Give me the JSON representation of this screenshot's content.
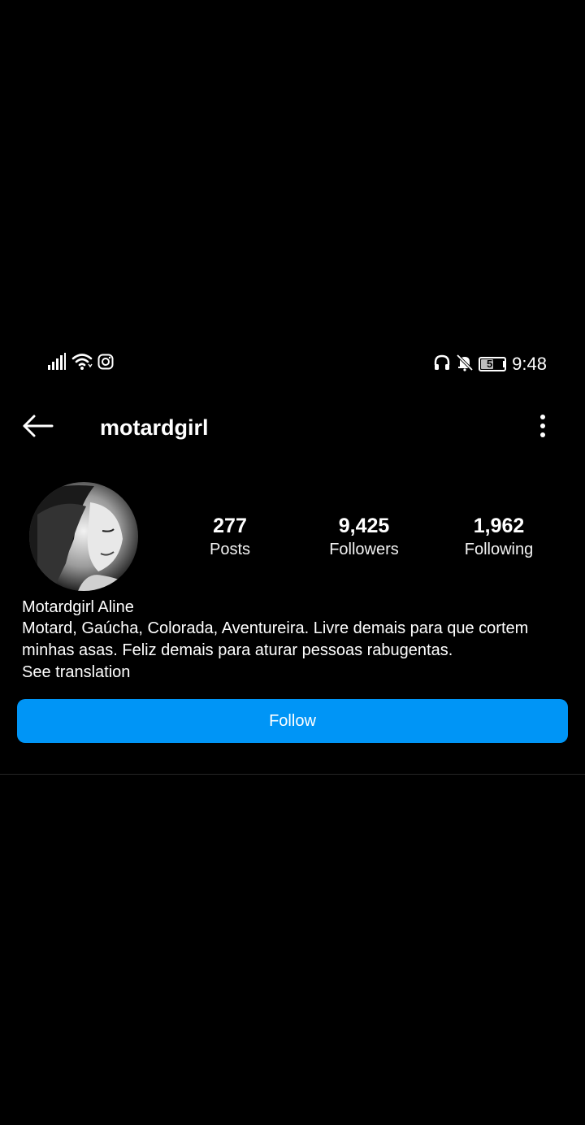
{
  "status_bar": {
    "time": "9:48",
    "battery": "57",
    "battery_level": 0.57,
    "left_icons": [
      "signal-icon",
      "wifi-icon",
      "instagram-icon"
    ],
    "right_icons": [
      "headphones-icon",
      "bell-off-icon",
      "battery-icon"
    ]
  },
  "header": {
    "username": "motardgirl",
    "back_icon": "arrow-left-icon",
    "menu_icon": "more-vertical-icon"
  },
  "profile": {
    "stats": [
      {
        "value": "277",
        "label": "Posts"
      },
      {
        "value": "9,425",
        "label": "Followers"
      },
      {
        "value": "1,962",
        "label": "Following"
      }
    ],
    "display_name": "Motardgirl Aline",
    "bio_lines": [
      "Motard, Gaúcha, Colorada, Aventureira. Livre demais para que cortem",
      "minhas asas. Feliz demais para aturar pessoas rabugentas."
    ],
    "see_translation": "See translation",
    "follow_label": "Follow"
  },
  "colors": {
    "background": "#000000",
    "accent": "#0095f6",
    "text": "#ffffff",
    "divider": "#262626"
  }
}
